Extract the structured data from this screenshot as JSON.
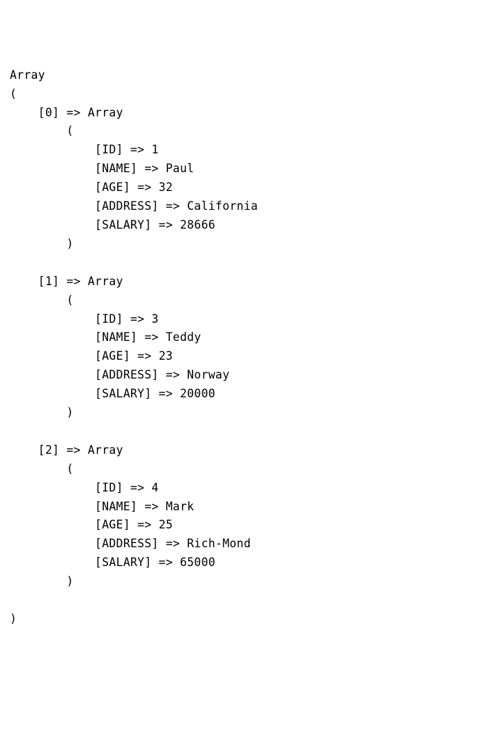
{
  "header": {
    "array_word": "Array",
    "open_paren": "(",
    "close_paren": ")"
  },
  "arrow": "=>",
  "inner_array_word": "Array",
  "indices": [
    "0",
    "1",
    "2"
  ],
  "keys": [
    "ID",
    "NAME",
    "AGE",
    "ADDRESS",
    "SALARY"
  ],
  "records": [
    {
      "ID": "1",
      "NAME": "Paul",
      "AGE": "32",
      "ADDRESS": "California",
      "SALARY": "28666"
    },
    {
      "ID": "3",
      "NAME": "Teddy",
      "AGE": "23",
      "ADDRESS": "Norway",
      "SALARY": "20000"
    },
    {
      "ID": "4",
      "NAME": "Mark",
      "AGE": "25",
      "ADDRESS": "Rich-Mond",
      "SALARY": "65000"
    }
  ]
}
